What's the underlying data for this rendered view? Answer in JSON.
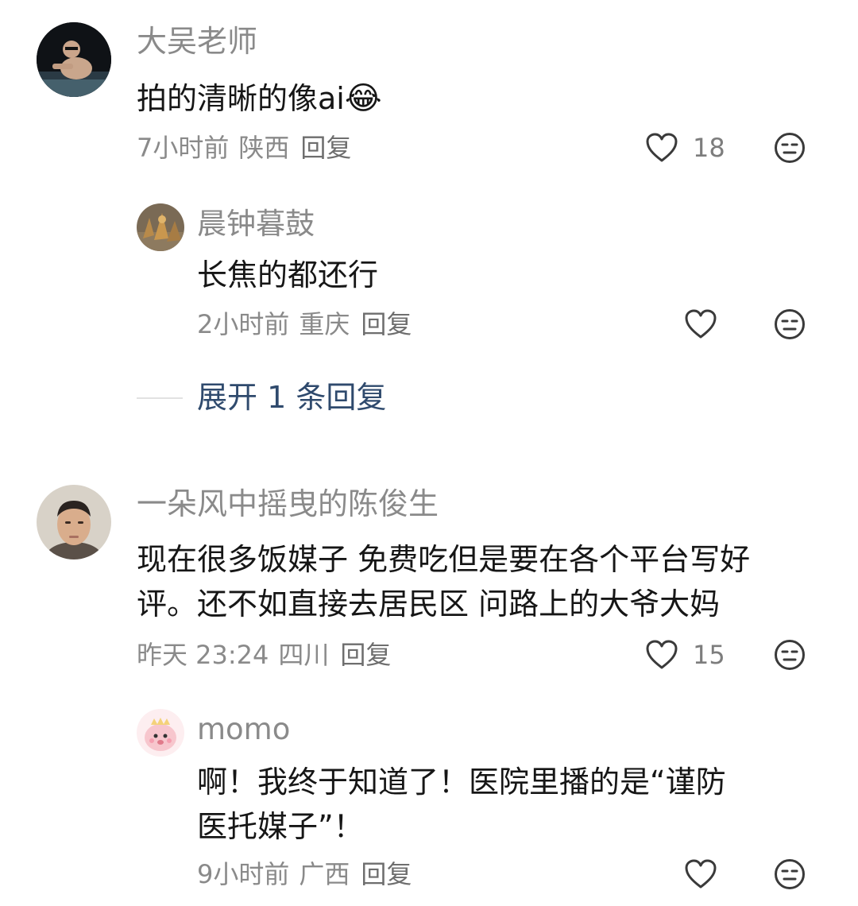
{
  "comments": [
    {
      "username": "大吴老师",
      "text": "拍的清晰的像ai",
      "emoji": "😂",
      "time": "7小时前",
      "location": "陕西",
      "reply_label": "回复",
      "likes": "18",
      "avatar_icon": "person-in-pool-avatar",
      "replies": [
        {
          "username": "晨钟暮鼓",
          "text": "长焦的都还行",
          "time": "2小时前",
          "location": "重庆",
          "reply_label": "回复",
          "avatar_icon": "statue-photo-avatar"
        }
      ],
      "expand_label": "展开 1 条回复"
    },
    {
      "username": "一朵风中摇曳的陈俊生",
      "text_line1": "现在很多饭媒子 免费吃但是要在各个平台写好",
      "text_line2": "评。还不如直接去居民区 问路上的大爷大妈",
      "time": "昨天 23:24",
      "location": "四川",
      "reply_label": "回复",
      "likes": "15",
      "avatar_icon": "man-portrait-avatar",
      "replies": [
        {
          "username": "momo",
          "text_line1": "啊！我终于知道了！医院里播的是“谨防",
          "text_line2": "医托媒子”！",
          "time": "9小时前",
          "location": "广西",
          "reply_label": "回复",
          "avatar_icon": "pink-cartoon-avatar"
        }
      ]
    }
  ],
  "colors": {
    "meta": "#8a8a8a",
    "body": "#161616",
    "expand": "#2f4a6d",
    "icon": "#333333"
  }
}
